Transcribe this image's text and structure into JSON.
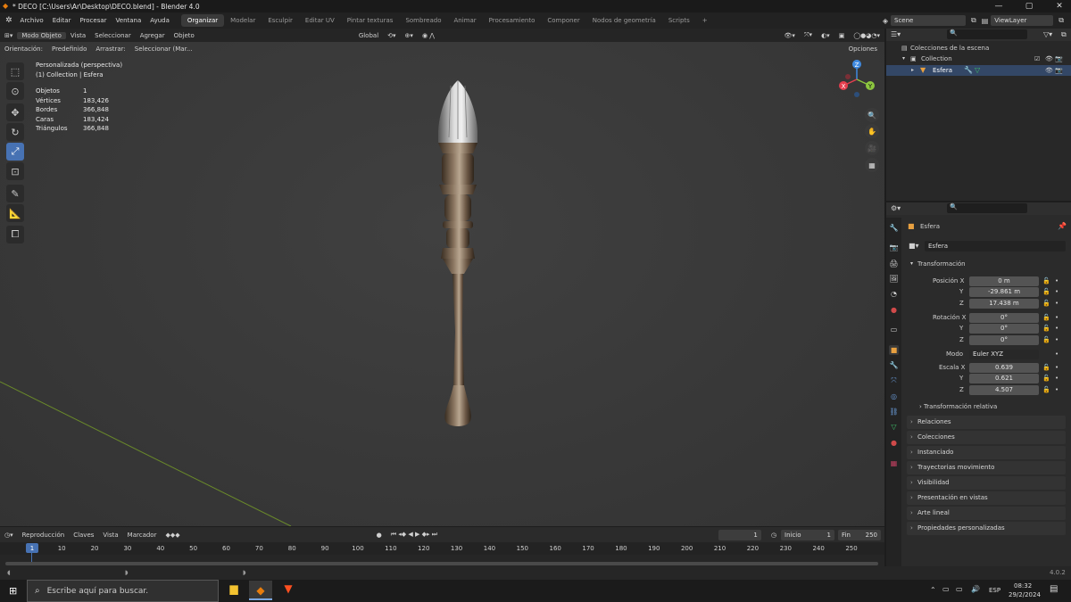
{
  "window": {
    "title": "* DECO [C:\\Users\\Ar\\Desktop\\DECO.blend] - Blender 4.0",
    "min_glyph": "—",
    "max_glyph": "▢",
    "close_glyph": "✕"
  },
  "menu": [
    "Archivo",
    "Editar",
    "Procesar",
    "Ventana",
    "Ayuda"
  ],
  "workspaces": [
    {
      "label": "Organizar",
      "active": true
    },
    {
      "label": "Modelar"
    },
    {
      "label": "Esculpir"
    },
    {
      "label": "Editar UV"
    },
    {
      "label": "Pintar texturas"
    },
    {
      "label": "Sombreado"
    },
    {
      "label": "Animar"
    },
    {
      "label": "Procesamiento"
    },
    {
      "label": "Componer"
    },
    {
      "label": "Nodos de geometría"
    },
    {
      "label": "Scripts"
    }
  ],
  "add_workspace": "+",
  "scene": {
    "name": "Scene"
  },
  "viewlayer": {
    "name": "ViewLayer"
  },
  "viewport_header": {
    "mode": "Modo Objeto",
    "menus": [
      "Vista",
      "Seleccionar",
      "Agregar",
      "Objeto"
    ],
    "transform": "Global"
  },
  "tool_settings": {
    "orientation_label": "Orientación:",
    "orientation_value": "Predefinido",
    "drag_label": "Arrastrar:",
    "drag_value": "Seleccionar (Mar...",
    "options": "Opciones"
  },
  "overlay_info": {
    "view": "Personalizada (perspectiva)",
    "collection": "(1) Collection | Esfera",
    "stats": [
      {
        "label": "Objetos",
        "value": "1"
      },
      {
        "label": "Vértices",
        "value": "183,426"
      },
      {
        "label": "Bordes",
        "value": "366,848"
      },
      {
        "label": "Caras",
        "value": "183,424"
      },
      {
        "label": "Triángulos",
        "value": "366,848"
      }
    ]
  },
  "gizmo": {
    "x": "X",
    "y": "Y",
    "z": "Z"
  },
  "outliner": {
    "root": "Colecciones de la escena",
    "collection": "Collection",
    "object": "Esfera"
  },
  "properties": {
    "object_name": "Esfera",
    "datablock": "Esfera",
    "transform_header": "Transformación",
    "location": {
      "label": "Posición X",
      "x": "0 m",
      "y": "-29.861 m",
      "z": "17.438 m"
    },
    "rotation": {
      "label": "Rotación X",
      "x": "0°",
      "y": "0°",
      "z": "0°"
    },
    "mode_label": "Modo",
    "mode_value": "Euler XYZ",
    "scale": {
      "label": "Escala X",
      "x": "0.639",
      "y": "0.621",
      "z": "4.507"
    },
    "axis_y": "Y",
    "axis_z": "Z",
    "delta": "Transformación relativa",
    "sections": [
      "Relaciones",
      "Colecciones",
      "Instanciado",
      "Trayectorias movimiento",
      "Visibilidad",
      "Presentación en vistas",
      "Arte lineal",
      "Propiedades personalizadas"
    ]
  },
  "timeline": {
    "menus": [
      "Reproducción",
      "Claves",
      "Vista",
      "Marcador"
    ],
    "current_frame": "1",
    "start_label": "Inicio",
    "start": "1",
    "end_label": "Fin",
    "end": "250",
    "ticks": [
      "1",
      "10",
      "20",
      "30",
      "40",
      "50",
      "60",
      "70",
      "80",
      "90",
      "100",
      "110",
      "120",
      "130",
      "140",
      "150",
      "160",
      "170",
      "180",
      "190",
      "200",
      "210",
      "220",
      "230",
      "240",
      "250"
    ]
  },
  "status": {
    "version": "4.0.2"
  },
  "taskbar": {
    "search_placeholder": "Escribe aquí para buscar.",
    "time": "08:32",
    "date": "29/2/2024",
    "lang": "ESP"
  },
  "colors": {
    "accent": "#4772b3",
    "x_axis": "#e53e4e",
    "y_axis": "#8cc63f",
    "z_axis": "#3f8ae0"
  }
}
